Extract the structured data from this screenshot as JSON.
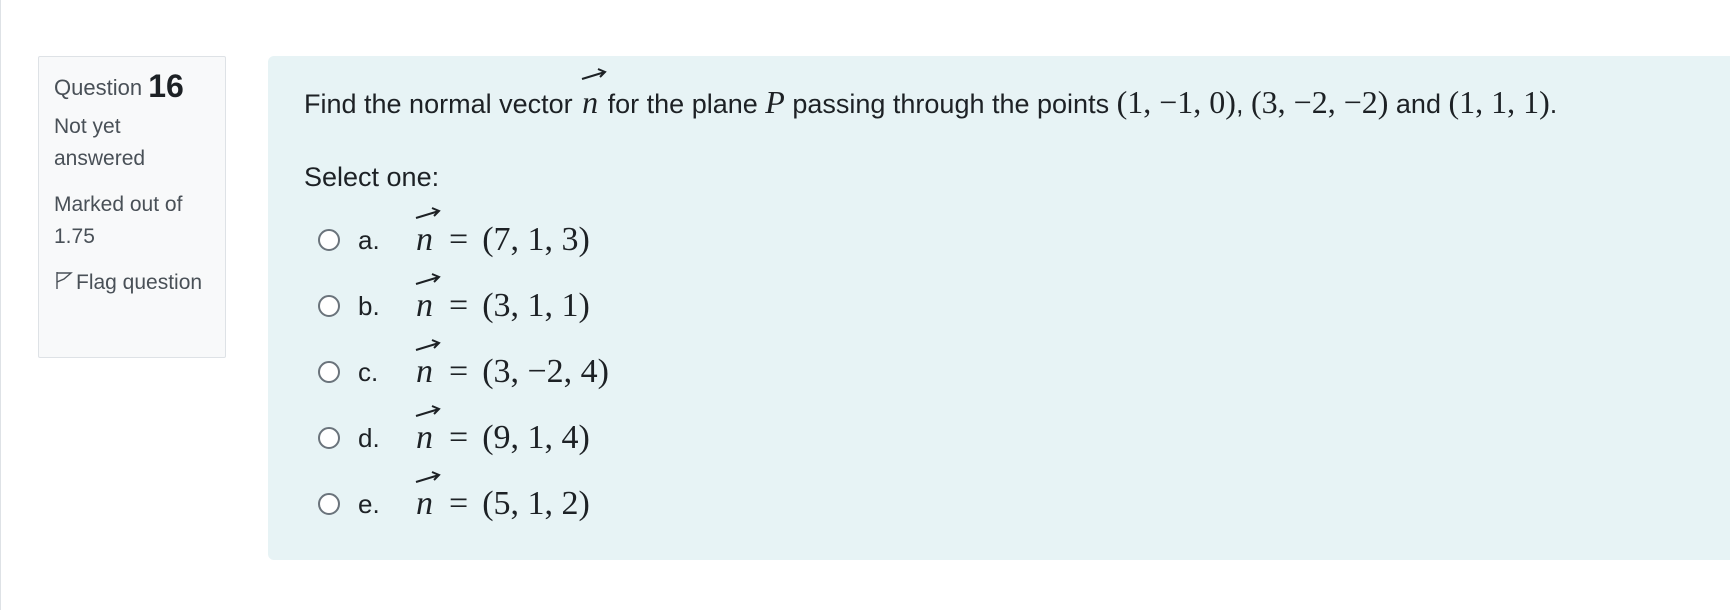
{
  "info": {
    "question_word": "Question",
    "question_number": "16",
    "state": "Not yet answered",
    "grade": "Marked out of 1.75",
    "flag_label": "Flag question"
  },
  "question": {
    "text_part1": "Find the normal vector",
    "vector_symbol": "n",
    "text_part2": "for the plane",
    "plane_symbol": "P",
    "text_part3": "passing through the points",
    "point1": "(1, −1, 0)",
    "sep1": ",",
    "point2": "(3, −2, −2)",
    "and_word": "and",
    "point3": "(1, 1, 1)",
    "end": "."
  },
  "prompt": "Select one:",
  "options": [
    {
      "letter": "a.",
      "equals": "=",
      "value": "(7, 1, 3)"
    },
    {
      "letter": "b.",
      "equals": "=",
      "value": "(3, 1, 1)"
    },
    {
      "letter": "c.",
      "equals": "=",
      "value": "(3, −2, 4)"
    },
    {
      "letter": "d.",
      "equals": "=",
      "value": "(9, 1, 4)"
    },
    {
      "letter": "e.",
      "equals": "=",
      "value": "(5, 1, 2)"
    }
  ]
}
